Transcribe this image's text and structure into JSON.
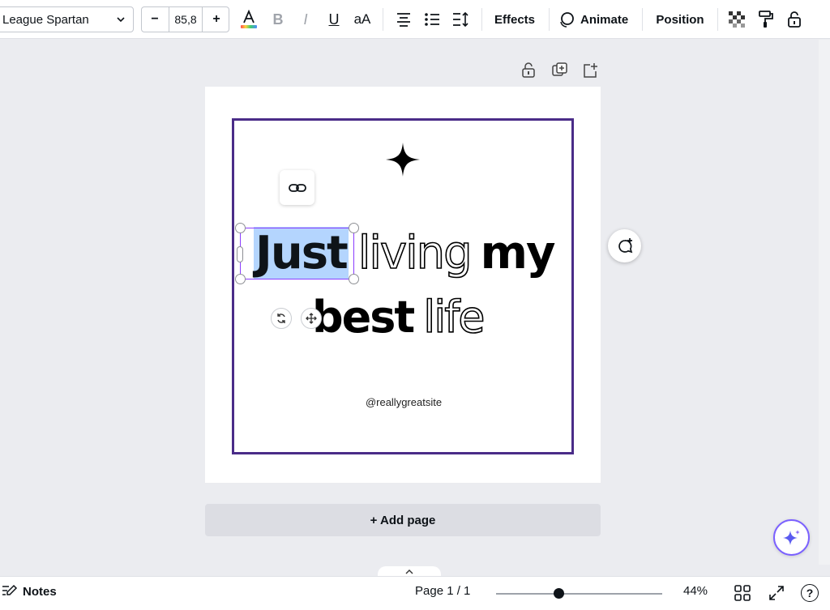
{
  "toolbar": {
    "font_name": "League Spartan",
    "font_size": "85,8",
    "minus": "−",
    "plus": "+",
    "bold": "B",
    "italic": "I",
    "underline": "U",
    "case": "aA",
    "effects": "Effects",
    "animate": "Animate",
    "position": "Position"
  },
  "design": {
    "line1_selected": "Just",
    "line1_outline": "living",
    "line1_solid": "my",
    "line2_solid": "best",
    "line2_outline": "life",
    "handle": "@reallygreatsite"
  },
  "canvas": {
    "add_page": "+ Add page"
  },
  "bottombar": {
    "notes": "Notes",
    "page_indicator": "Page 1 / 1",
    "zoom": "44%",
    "help": "?"
  },
  "colors": {
    "selection": "#8b3dff",
    "highlight": "#b4d5fe",
    "frame": "#4a2c88"
  }
}
